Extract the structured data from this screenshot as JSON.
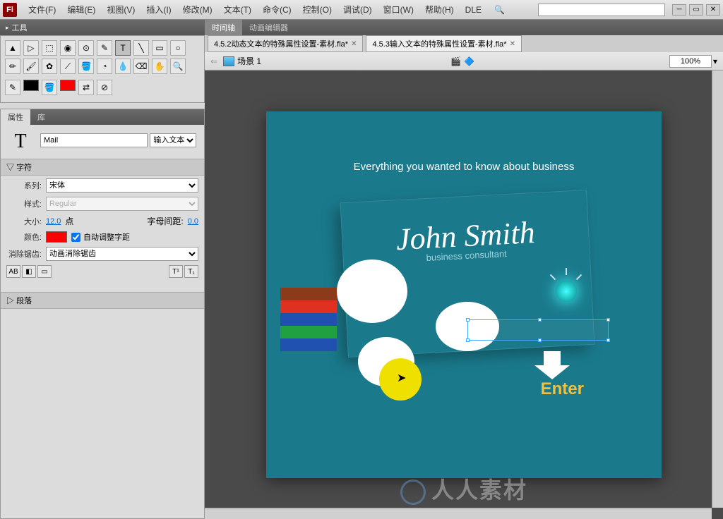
{
  "menubar": {
    "items": [
      "文件(F)",
      "编辑(E)",
      "视图(V)",
      "插入(I)",
      "修改(M)",
      "文本(T)",
      "命令(C)",
      "控制(O)",
      "调试(D)",
      "窗口(W)",
      "帮助(H)",
      "DLE"
    ]
  },
  "panels": {
    "tools_title": "工具",
    "props_tabs": [
      "属性",
      "库"
    ],
    "timeline_tabs": [
      "时间轴",
      "动画编辑器"
    ]
  },
  "properties": {
    "instance_name": "Mail",
    "text_type": "输入文本",
    "char_section": "字符",
    "para_section": "段落",
    "family_label": "系列:",
    "family_value": "宋体",
    "style_label": "样式:",
    "style_value": "Regular",
    "size_label": "大小:",
    "size_value": "12.0",
    "size_unit": "点",
    "spacing_label": "字母间距:",
    "spacing_value": "0.0",
    "color_label": "颜色:",
    "autokern_label": "自动调整字距",
    "antialias_label": "消除锯齿:",
    "antialias_value": "动画消除锯齿"
  },
  "documents": {
    "tabs": [
      {
        "name": "4.5.2动态文本的特殊属性设置-素材.fla*",
        "active": false
      },
      {
        "name": "4.5.3输入文本的特殊属性设置-素材.fla*",
        "active": true
      }
    ],
    "scene_label": "场景 1",
    "zoom": "100%"
  },
  "stage": {
    "subtitle": "Everything you wanted to know about business",
    "name": "John Smith",
    "role": "business consultant",
    "enter": "Enter"
  },
  "watermark": "人人素材"
}
